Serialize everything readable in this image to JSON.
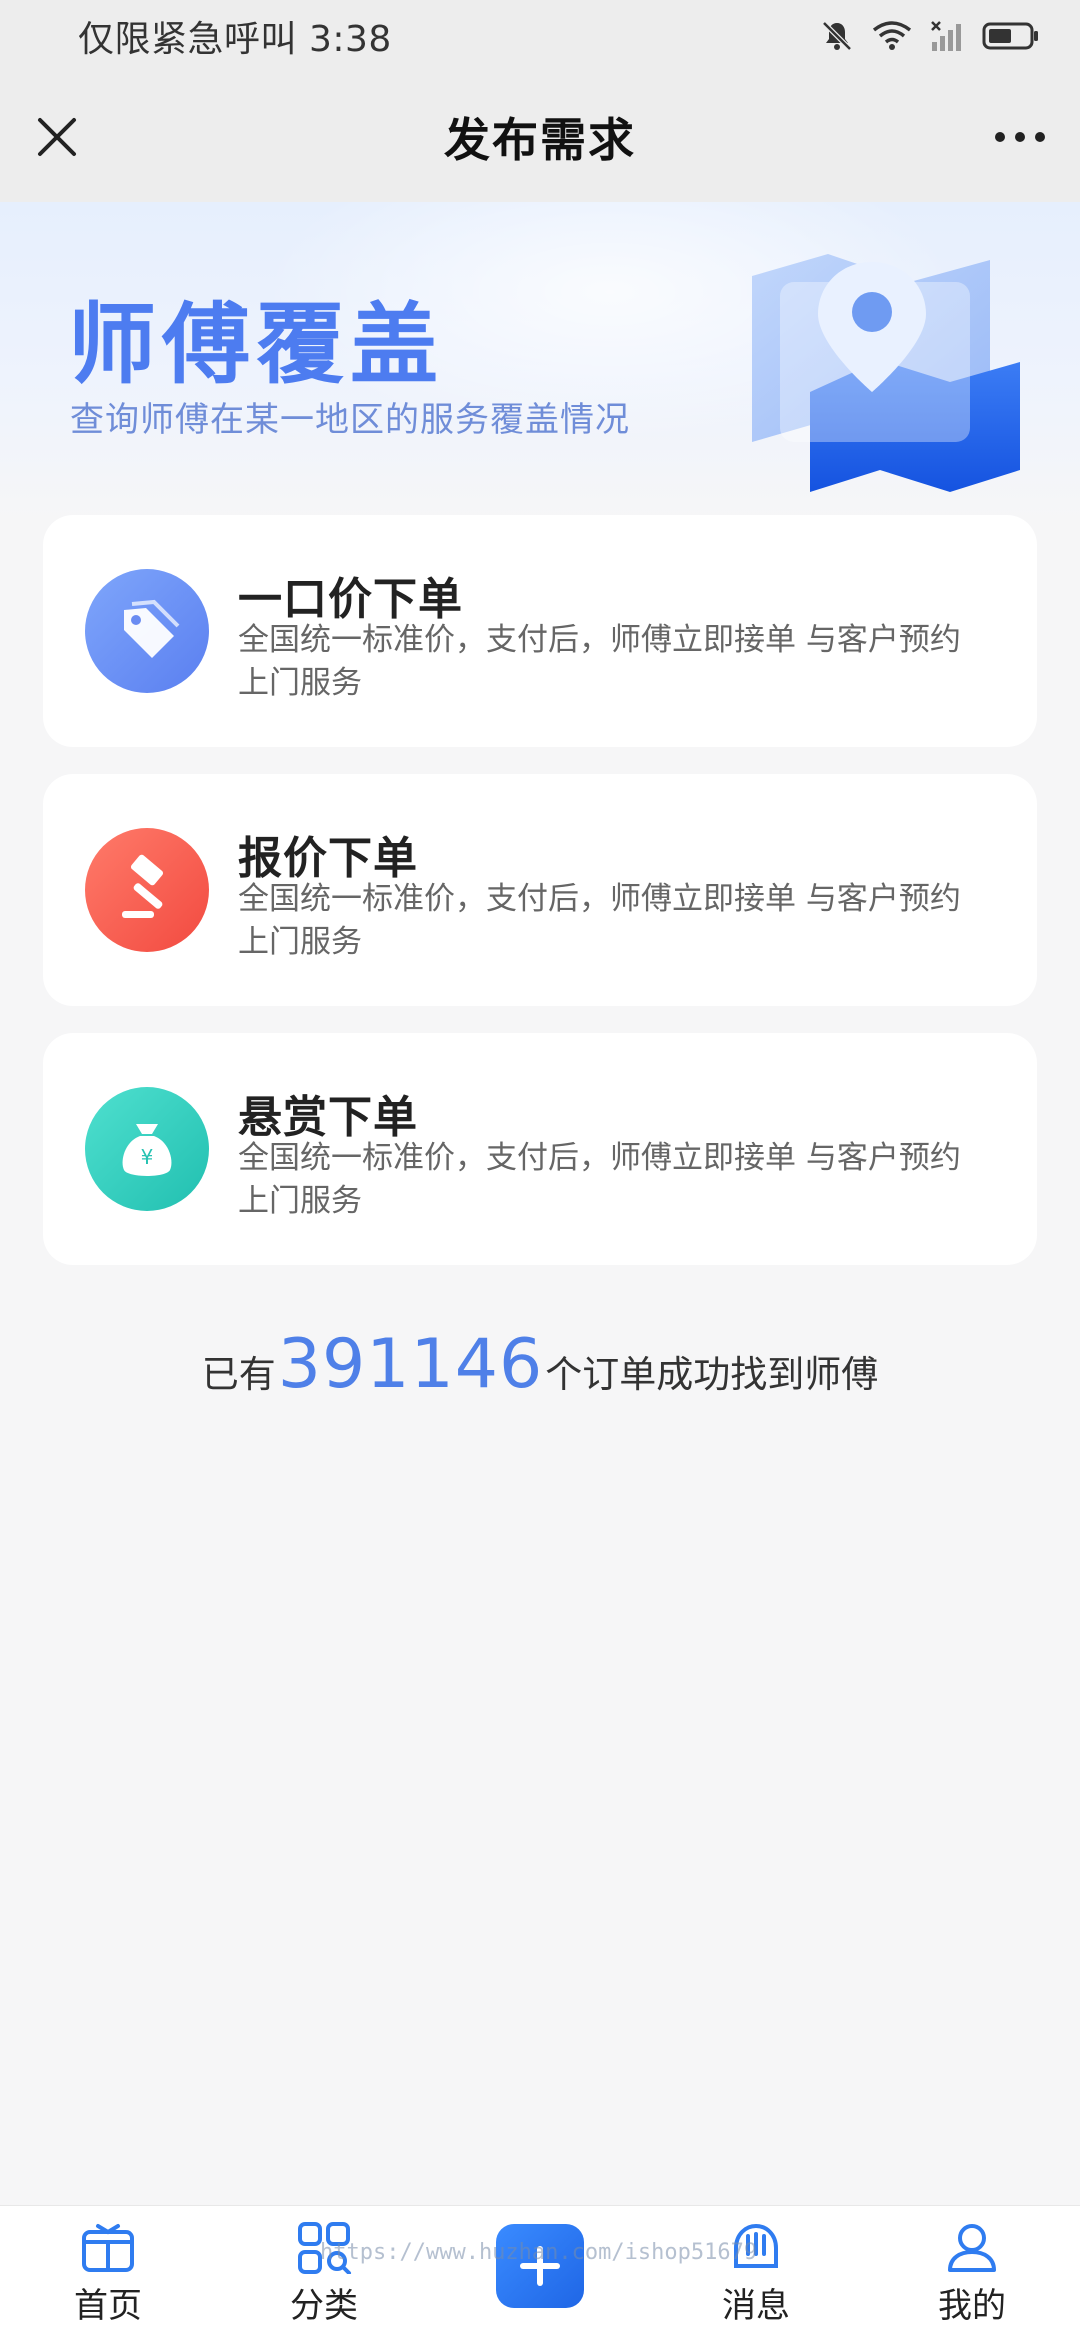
{
  "status_bar": {
    "carrier_text": "仅限紧急呼叫 3:38",
    "icons": [
      "bell-muted-icon",
      "wifi-icon",
      "signal-icon",
      "battery-icon"
    ]
  },
  "nav": {
    "title": "发布需求",
    "close_icon": "close-icon",
    "more_icon": "more-icon"
  },
  "banner": {
    "title": "师傅覆盖",
    "subtitle": "查询师傅在某一地区的服务覆盖情况",
    "illustration": "map-pin-icon"
  },
  "options": [
    {
      "title": "一口价下单",
      "desc": "全国统一标准价，支付后，师傅立即接单 与客户预约上门服务",
      "icon": "price-tag-icon",
      "color": "#5a7ff0"
    },
    {
      "title": "报价下单",
      "desc": "全国统一标准价，支付后，师傅立即接单 与客户预约上门服务",
      "icon": "gavel-icon",
      "color": "#f24a40"
    },
    {
      "title": "悬赏下单",
      "desc": "全国统一标准价，支付后，师傅立即接单 与客户预约上门服务",
      "icon": "money-bag-icon",
      "color": "#21bfb0"
    }
  ],
  "stats": {
    "prefix": "已有",
    "count": "391146",
    "suffix": "个订单成功找到师傅"
  },
  "tabs": [
    {
      "label": "首页",
      "icon": "home-icon"
    },
    {
      "label": "分类",
      "icon": "category-icon"
    },
    {
      "label": "",
      "icon": "publish-plus-icon"
    },
    {
      "label": "消息",
      "icon": "message-icon"
    },
    {
      "label": "我的",
      "icon": "user-icon"
    }
  ],
  "watermark": "https://www.huzhan.com/ishop51679",
  "colors": {
    "accent": "#4f80e8",
    "background": "#f6f6f7",
    "card": "#ffffff"
  }
}
